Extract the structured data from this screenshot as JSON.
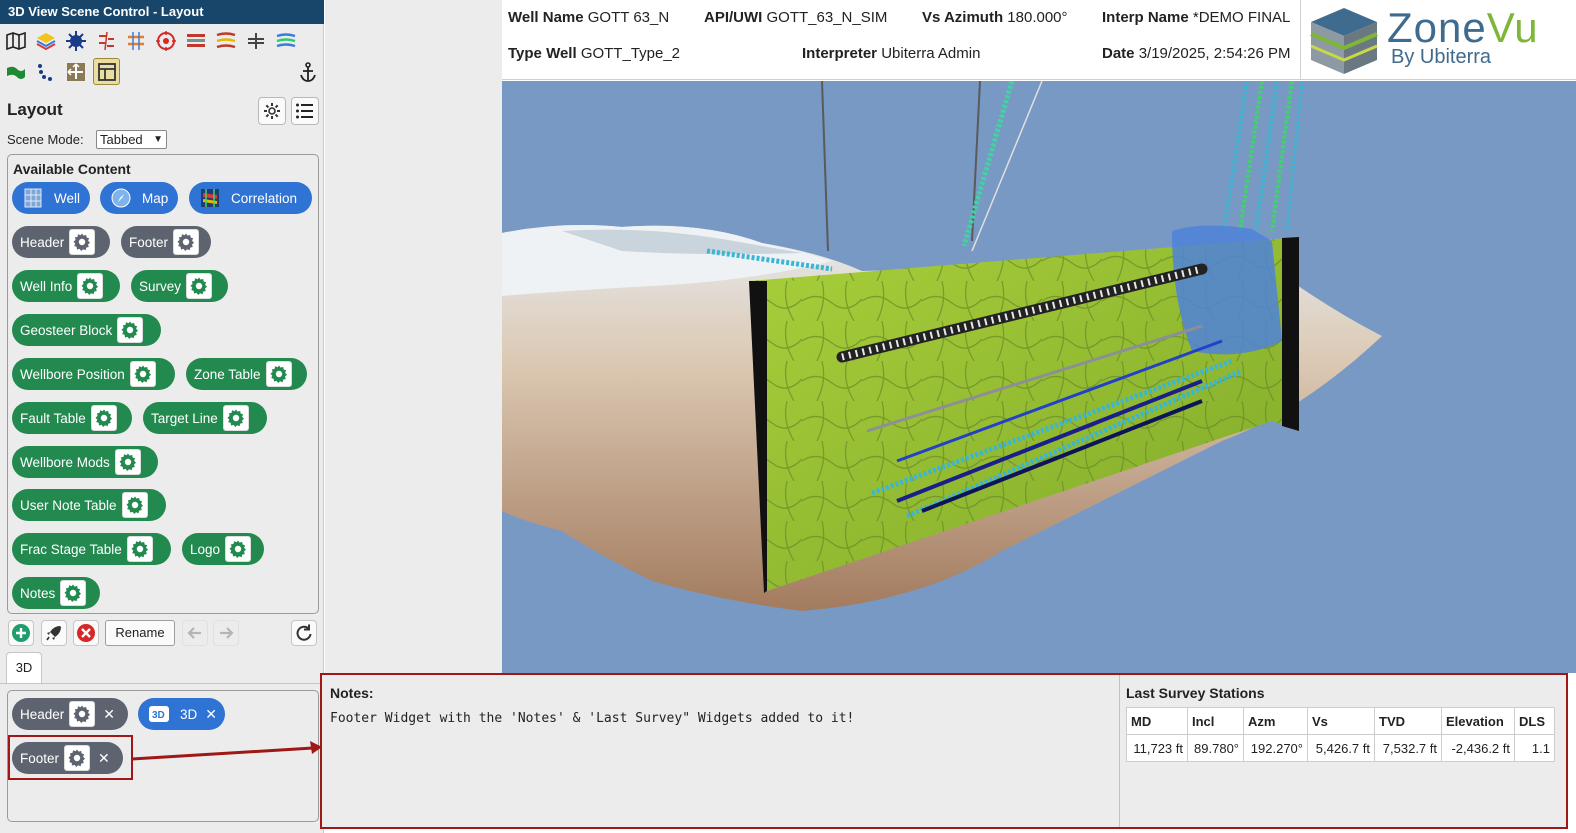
{
  "window": {
    "title": "3D View Scene Control - Layout"
  },
  "toolbar": {
    "row1": [
      "map-icon",
      "layers-icon",
      "star-burst-icon",
      "fault-icon",
      "grid-cross-icon",
      "target-icon",
      "strata-icon",
      "stripes-icon",
      "split-icon",
      "horizons-icon"
    ],
    "row2": [
      "flag-icon",
      "dots-icon",
      "move-icon",
      "layout-icon"
    ],
    "anchor": "anchor-icon"
  },
  "layout": {
    "title": "Layout",
    "scene_mode_label": "Scene Mode:",
    "scene_mode_value": "Tabbed",
    "available_title": "Available Content",
    "content_items": [
      {
        "label": "Well",
        "color": "blue"
      },
      {
        "label": "Map",
        "color": "blue"
      },
      {
        "label": "Correlation",
        "color": "blue"
      },
      {
        "label": "Header",
        "color": "gray"
      },
      {
        "label": "Footer",
        "color": "gray"
      },
      {
        "label": "Well Info",
        "color": "green"
      },
      {
        "label": "Survey",
        "color": "green"
      },
      {
        "label": "Geosteer Block",
        "color": "green"
      },
      {
        "label": "Wellbore Position",
        "color": "green"
      },
      {
        "label": "Zone Table",
        "color": "green"
      },
      {
        "label": "Fault Table",
        "color": "green"
      },
      {
        "label": "Target Line",
        "color": "green"
      },
      {
        "label": "Wellbore Mods",
        "color": "green"
      },
      {
        "label": "User Note Table",
        "color": "green"
      },
      {
        "label": "Frac Stage Table",
        "color": "green"
      },
      {
        "label": "Logo",
        "color": "green"
      },
      {
        "label": "Notes",
        "color": "green"
      }
    ],
    "rename_label": "Rename",
    "tab_label": "3D",
    "scene_items": [
      {
        "label": "Header"
      },
      {
        "label": "3D"
      },
      {
        "label": "Footer"
      }
    ]
  },
  "header": {
    "well_name_label": "Well Name",
    "well_name": "GOTT 63_N",
    "api_label": "API/UWI",
    "api": "GOTT_63_N_SIM",
    "vs_azimuth_label": "Vs Azimuth",
    "vs_azimuth": "180.000°",
    "interp_name_label": "Interp Name",
    "interp_name": "*DEMO FINAL",
    "type_well_label": "Type Well",
    "type_well": "GOTT_Type_2",
    "interpreter_label": "Interpreter",
    "interpreter": "Ubiterra Admin",
    "date_label": "Date",
    "date": "3/19/2025, 2:54:26 PM"
  },
  "logo": {
    "brand_main": "Zone",
    "brand_accent": "Vu",
    "brand_sub": "By Ubiterra"
  },
  "footer": {
    "notes_title": "Notes:",
    "notes_text": "Footer Widget with the 'Notes' & 'Last Survey\" Widgets added to it!",
    "survey_title": "Last Survey Stations",
    "survey_headers": [
      "MD",
      "Incl",
      "Azm",
      "Vs",
      "TVD",
      "Elevation",
      "DLS"
    ],
    "survey_row": [
      "11,723 ft",
      "89.780°",
      "192.270°",
      "5,426.7 ft",
      "7,532.7 ft",
      "-2,436.2 ft",
      "1.1"
    ]
  },
  "colors": {
    "title_bar": "#17466a",
    "pill_blue": "#2f73d4",
    "pill_green": "#238a4f",
    "pill_gray": "#5d6470",
    "highlight_red": "#a01717",
    "viewport_bg": "#7899c4"
  }
}
